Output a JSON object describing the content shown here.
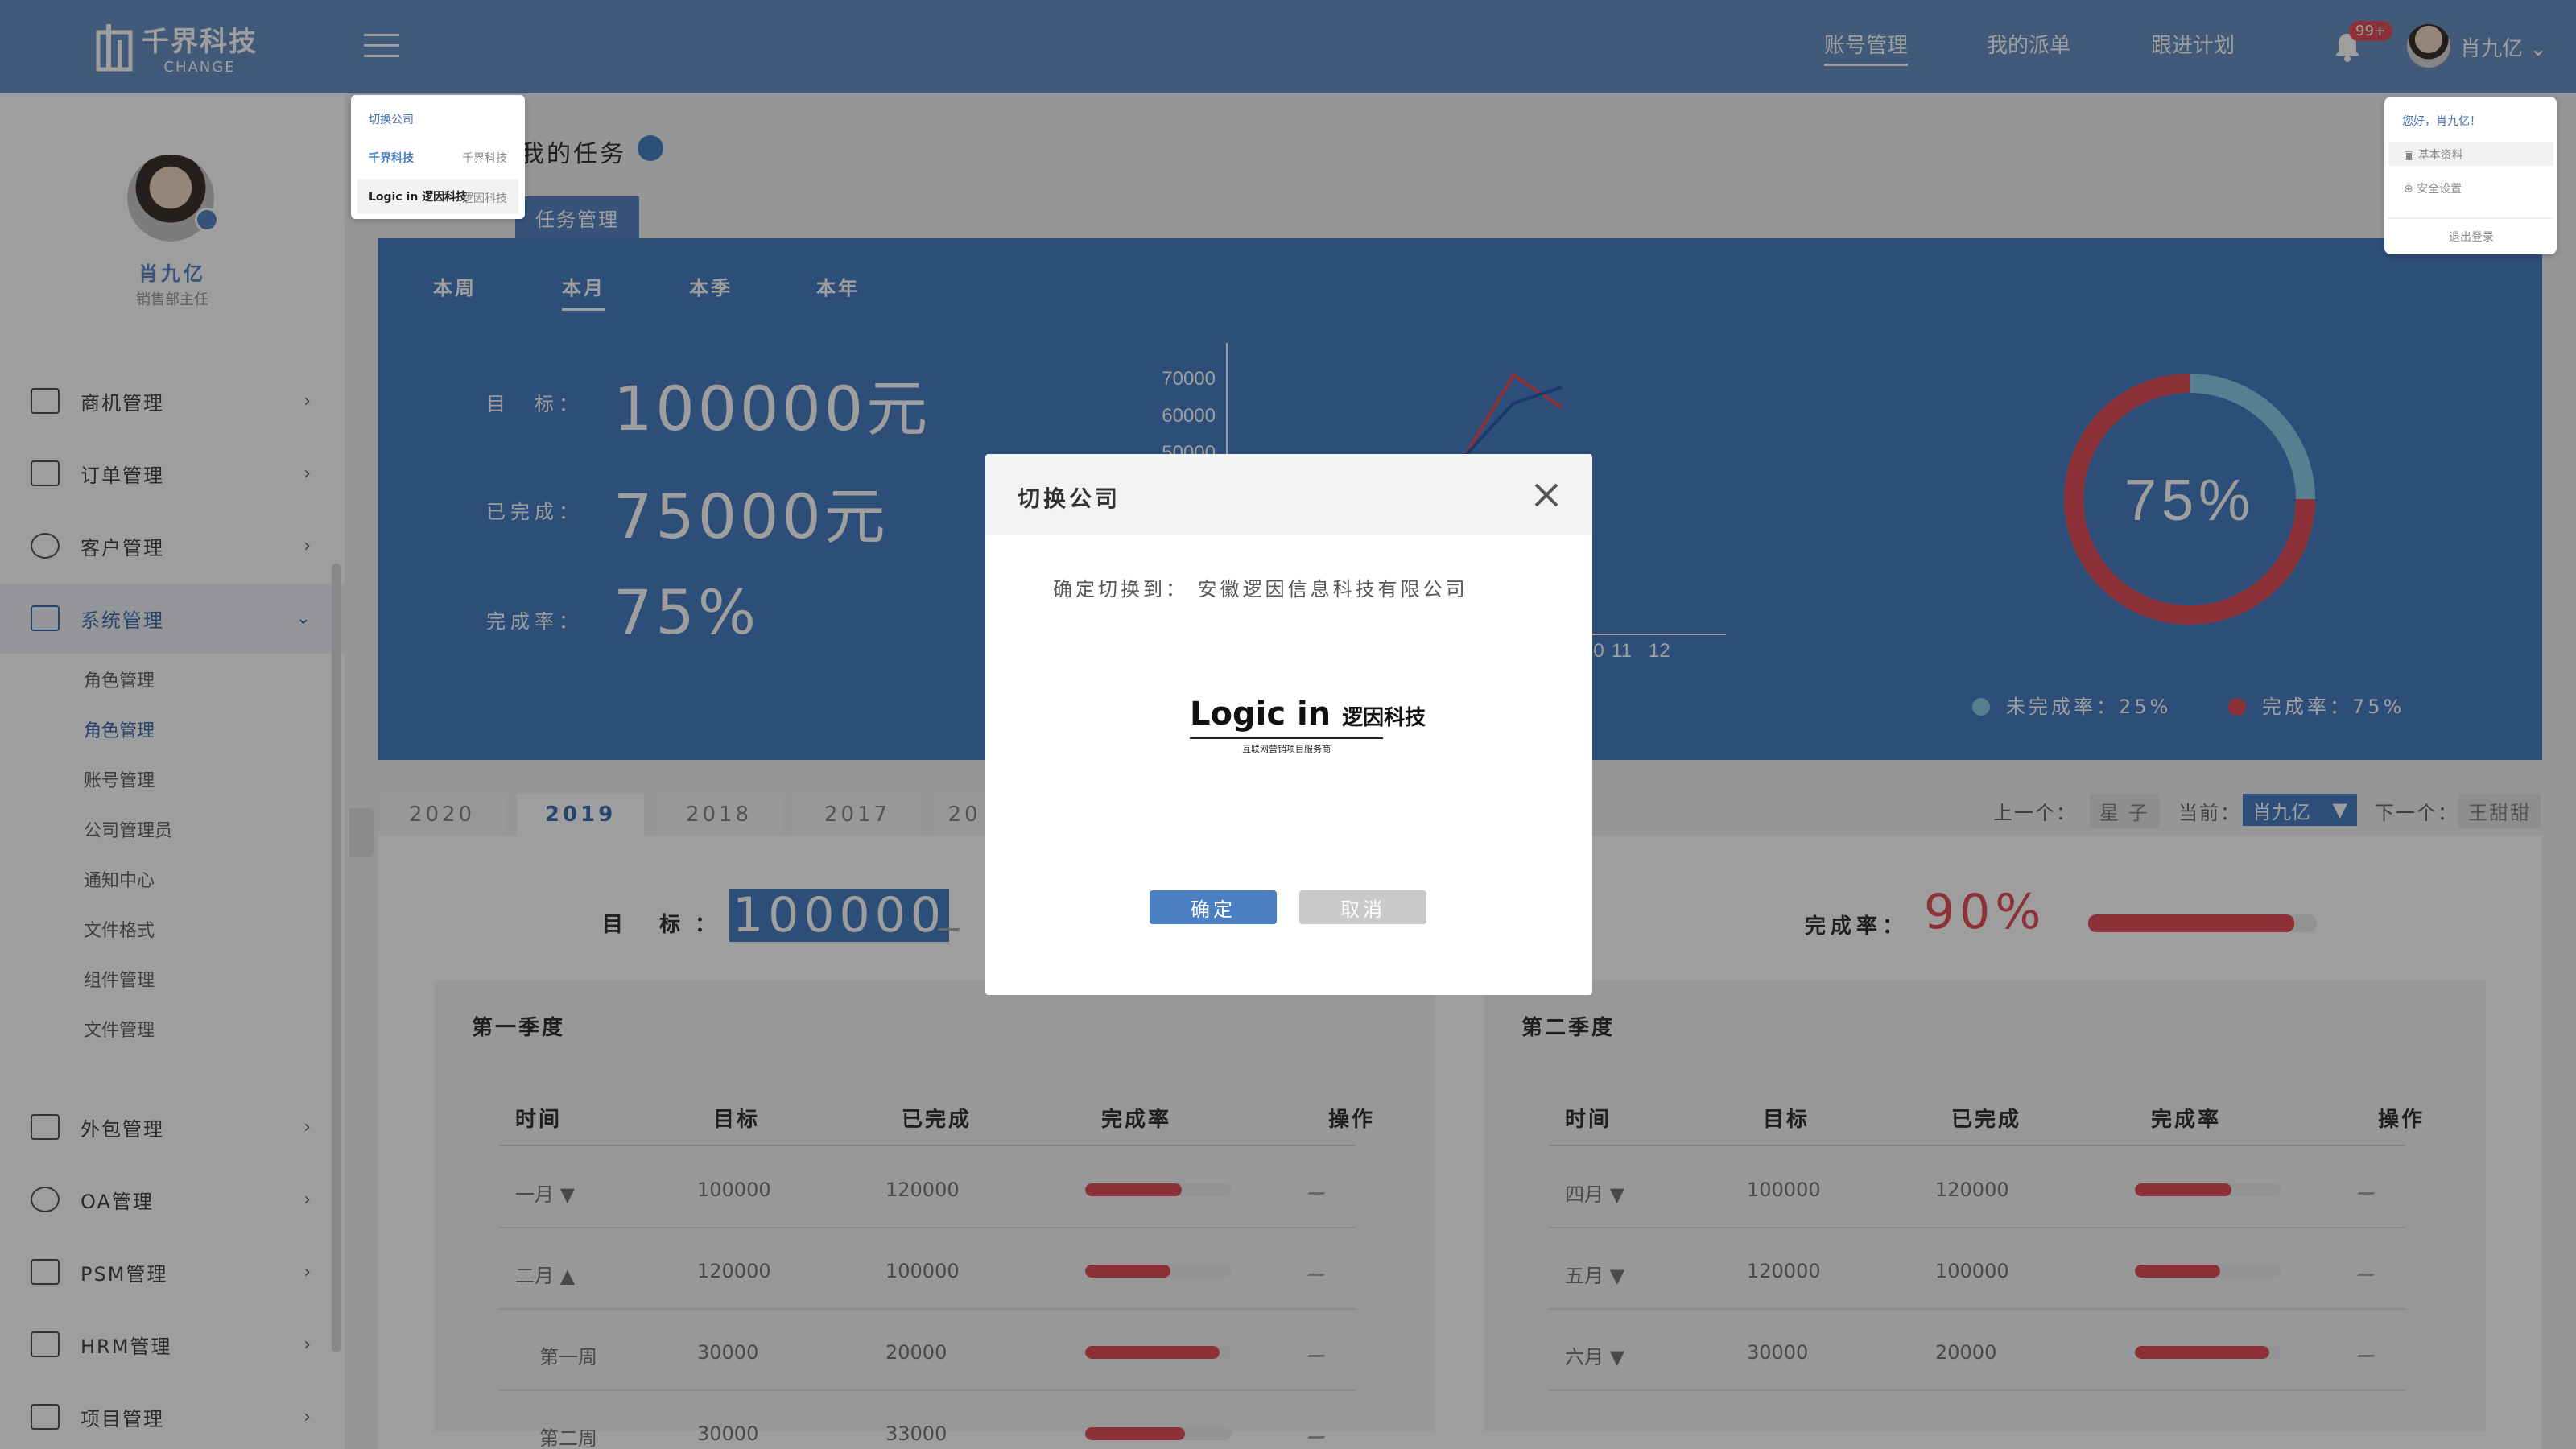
{
  "topbar": {
    "logo_cn": "千界科技",
    "logo_en": "CHANGE",
    "nav": [
      "账号管理",
      "我的派单",
      "跟进计划"
    ],
    "badge": "99+",
    "user": "肖九亿"
  },
  "sidebar": {
    "name": "肖九亿",
    "role": "销售部主任",
    "menu": [
      "商机管理",
      "订单管理",
      "客户管理",
      "系统管理",
      "外包管理",
      "OA管理",
      "PSM管理",
      "HRM管理",
      "项目管理"
    ],
    "sub": [
      "角色管理",
      "角色管理",
      "账号管理",
      "公司管理员",
      "通知中心",
      "文件格式",
      "组件管理",
      "文件管理"
    ]
  },
  "page": {
    "title": "我的任务",
    "tab": "任务管理",
    "period_tabs": [
      "本周",
      "本月",
      "本季",
      "本年"
    ],
    "labels": {
      "target": "目　标：",
      "done": "已完成：",
      "rate": "完成率："
    },
    "values": {
      "target": "100000元",
      "done": "75000元",
      "rate": "75%"
    },
    "donut_text": "75%",
    "legend_undone": "未完成率：25%",
    "legend_done": "完成率：75%",
    "years": [
      "2020",
      "2019",
      "2018",
      "2017",
      "20"
    ],
    "nav": {
      "prev": "上一个：",
      "prev_name": "星 子",
      "current": "当前：",
      "current_name": "肖九亿",
      "next": "下一个：",
      "next_name": "王甜甜"
    },
    "target_label": "目 标：",
    "target_value": "100000",
    "rate_label": "完成率：",
    "rate_value": "90%",
    "rate_pct": 90
  },
  "q1": {
    "title": "第一季度",
    "headers": [
      "时间",
      "目标",
      "已完成",
      "完成率",
      "操作"
    ],
    "rows": [
      {
        "time": "一月 ▼",
        "target": "100000",
        "done": "120000",
        "pct": 66
      },
      {
        "time": "二月 ▲",
        "target": "120000",
        "done": "100000",
        "pct": 58
      },
      {
        "time": "第一周",
        "target": "30000",
        "done": "20000",
        "pct": 92
      },
      {
        "time": "第二周",
        "target": "30000",
        "done": "33000",
        "pct": 68
      }
    ]
  },
  "q2": {
    "title": "第二季度",
    "headers": [
      "时间",
      "目标",
      "已完成",
      "完成率",
      "操作"
    ],
    "rows": [
      {
        "time": "四月 ▼",
        "target": "100000",
        "done": "120000",
        "pct": 66
      },
      {
        "time": "五月 ▼",
        "target": "120000",
        "done": "100000",
        "pct": 58
      },
      {
        "time": "六月 ▼",
        "target": "30000",
        "done": "20000",
        "pct": 92
      }
    ]
  },
  "chart_data": {
    "type": "line",
    "yticks": [
      "70000",
      "60000",
      "50000"
    ],
    "xticks": [
      "10",
      "11",
      "12"
    ],
    "series": [
      {
        "color": "#e3505a",
        "values": [
          50000,
          70000,
          62000
        ]
      },
      {
        "color": "#2a5caa",
        "values": [
          50000,
          63000,
          67000
        ]
      }
    ]
  },
  "dropdown": {
    "title": "切换公司",
    "items": [
      {
        "logo": "千界科技",
        "name": "千界科技"
      },
      {
        "logo": "Logic in 逻因科技",
        "name": "逻因科技"
      }
    ]
  },
  "usermenu": {
    "greet": "您好，肖九亿！",
    "items": [
      "基本资料",
      "安全设置"
    ],
    "logout": "退出登录"
  },
  "modal": {
    "title": "切换公司",
    "text": "确定切换到：  安徽逻因信息科技有限公司",
    "logo_main": "Logic in",
    "logo_cn": "逻因科技",
    "logo_sub": "互联网营销项目服务商",
    "ok": "确定",
    "cancel": "取消"
  },
  "colors": {
    "primary": "#4a7fc3",
    "danger": "#e3505a",
    "undone": "#8ecde8"
  }
}
